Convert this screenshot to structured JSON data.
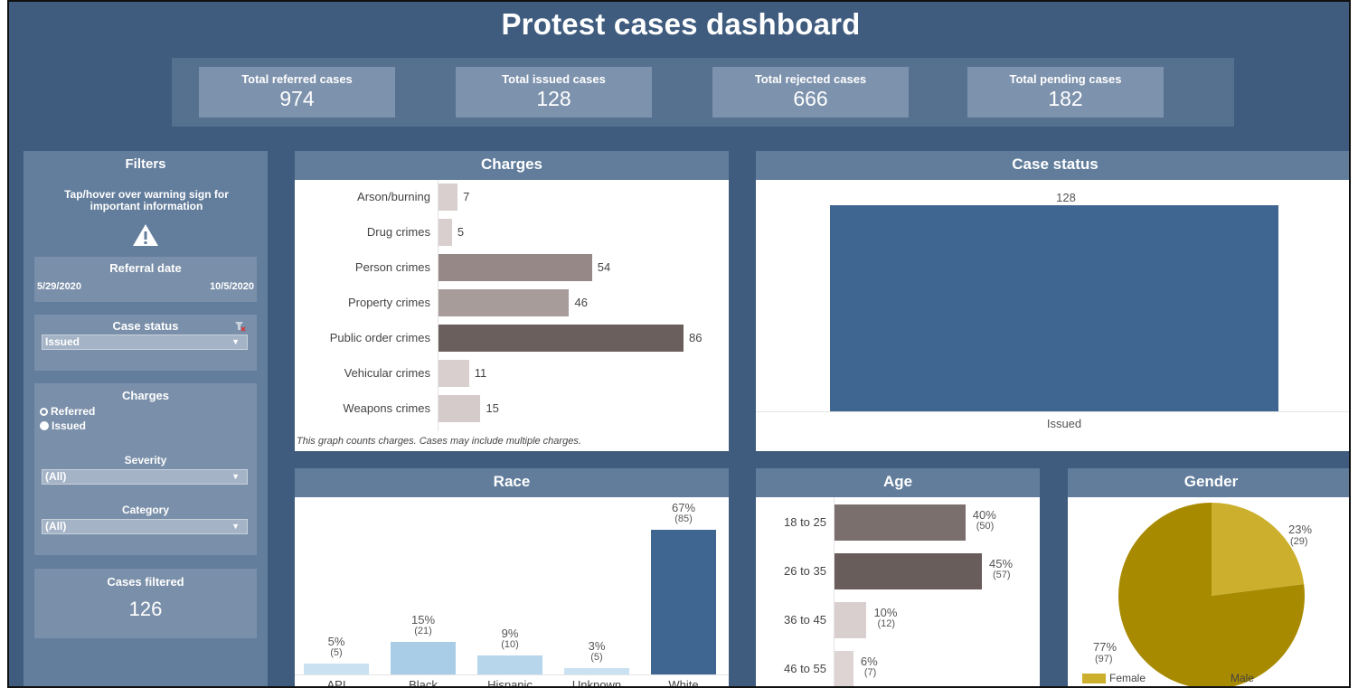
{
  "title": "Protest cases dashboard",
  "kpis": [
    {
      "label": "Total referred cases",
      "value": "974"
    },
    {
      "label": "Total issued cases",
      "value": "128"
    },
    {
      "label": "Total rejected cases",
      "value": "666"
    },
    {
      "label": "Total pending cases",
      "value": "182"
    }
  ],
  "filters": {
    "title": "Filters",
    "warning_text": "Tap/hover over warning sign for important information",
    "referral_date": {
      "label": "Referral date",
      "start": "5/29/2020",
      "end": "10/5/2020"
    },
    "case_status": {
      "label": "Case status",
      "value": "Issued"
    },
    "charges": {
      "label": "Charges",
      "options": [
        "Referred",
        "Issued"
      ],
      "severity_label": "Severity",
      "severity_value": "(All)",
      "category_label": "Category",
      "category_value": "(All)"
    },
    "cases_filtered": {
      "label": "Cases filtered",
      "value": "126"
    }
  },
  "panels": {
    "charges": "Charges",
    "case_status": "Case status",
    "race": "Race",
    "age": "Age",
    "gender": "Gender"
  },
  "charges_note": "This graph counts charges. Cases may include multiple charges.",
  "colors": {
    "background": "#3f5c7f",
    "kpi": "#7d92ad",
    "panel_header": "#617d9b",
    "status_bar": "#3f6690",
    "race_light": "#a9cde6",
    "gender_female": "#ccaf2c",
    "gender_male": "#a88a00"
  },
  "chart_data": [
    {
      "type": "bar",
      "orientation": "horizontal",
      "title": "Charges",
      "categories": [
        "Arson/burning",
        "Drug crimes",
        "Person crimes",
        "Property crimes",
        "Public order crimes",
        "Vehicular crimes",
        "Weapons crimes"
      ],
      "values": [
        7,
        5,
        54,
        46,
        86,
        11,
        15
      ],
      "colors": [
        "#d9cfce",
        "#d9cfce",
        "#958886",
        "#a79c9a",
        "#6b5f5d",
        "#d9cfce",
        "#d4cbca"
      ]
    },
    {
      "type": "bar",
      "title": "Case status",
      "categories": [
        "Issued"
      ],
      "values": [
        128
      ]
    },
    {
      "type": "bar",
      "title": "Race",
      "categories": [
        "API",
        "Black",
        "Hispanic",
        "Unknown",
        "White"
      ],
      "percent_labels": [
        "5%",
        "15%",
        "9%",
        "3%",
        "67%"
      ],
      "count_labels": [
        "(5)",
        "(21)",
        "(10)",
        "(5)",
        "(85)"
      ],
      "values": [
        5,
        15,
        9,
        3,
        67
      ],
      "colors": [
        "#c9e1f1",
        "#a9cde6",
        "#b7d6ec",
        "#c9e1f1",
        "#3f6690"
      ]
    },
    {
      "type": "bar",
      "orientation": "horizontal",
      "title": "Age",
      "categories": [
        "18 to 25",
        "26 to 35",
        "36 to 45",
        "46 to 55"
      ],
      "percent_labels": [
        "40%",
        "45%",
        "10%",
        "6%"
      ],
      "count_labels": [
        "(50)",
        "(57)",
        "(12)",
        "(7)"
      ],
      "values": [
        40,
        45,
        10,
        6
      ],
      "colors": [
        "#7b6f6d",
        "#685d5b",
        "#d9cfce",
        "#ddd4d3"
      ]
    },
    {
      "type": "pie",
      "title": "Gender",
      "categories": [
        "Female",
        "Male"
      ],
      "percent_labels": [
        "23%",
        "77%"
      ],
      "count_labels": [
        "(29)",
        "(97)"
      ],
      "values": [
        23,
        77
      ],
      "colors": [
        "#ccaf2c",
        "#a88a00"
      ]
    }
  ]
}
